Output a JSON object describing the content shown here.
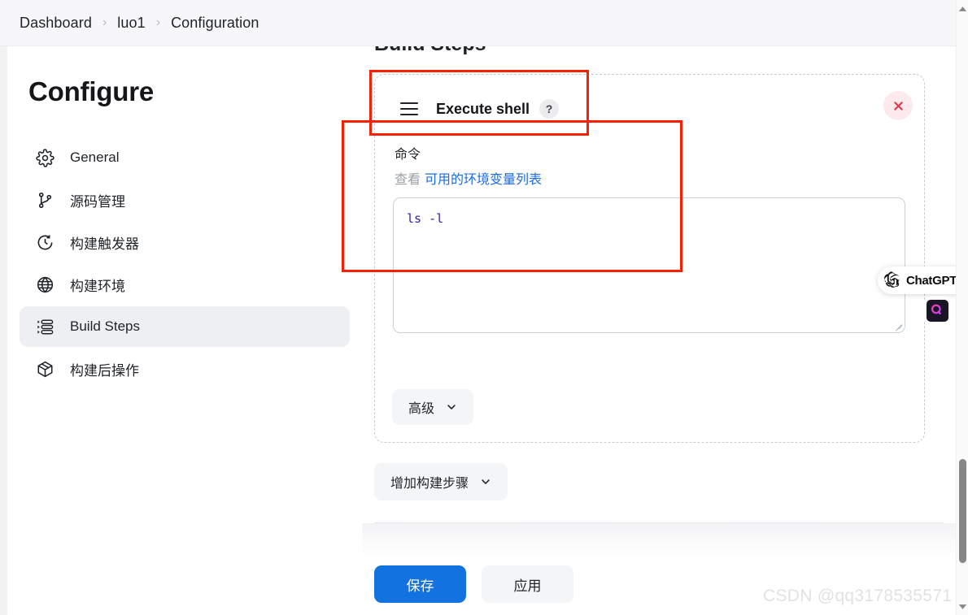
{
  "breadcrumb": {
    "items": [
      "Dashboard",
      "luo1",
      "Configuration"
    ],
    "separator": "›"
  },
  "sidebar": {
    "title": "Configure",
    "items": [
      {
        "label": "General",
        "icon": "gear-icon",
        "active": false
      },
      {
        "label": "源码管理",
        "icon": "source-branch-icon",
        "active": false
      },
      {
        "label": "构建触发器",
        "icon": "clock-icon",
        "active": false
      },
      {
        "label": "构建环境",
        "icon": "globe-icon",
        "active": false
      },
      {
        "label": "Build Steps",
        "icon": "list-icon",
        "active": true
      },
      {
        "label": "构建后操作",
        "icon": "package-icon",
        "active": false
      }
    ]
  },
  "main": {
    "section_heading": "Build Steps",
    "step": {
      "title": "Execute shell",
      "drag_handle_icon": "drag-handle-icon",
      "help_icon": "help-question-icon",
      "close_icon": "close-x-icon",
      "field_label": "命令",
      "hint_prefix": "查看",
      "hint_link": "可用的环境变量列表",
      "command_value": "ls -l",
      "command_placeholder": "",
      "advanced_label": "高级",
      "chevron_icon": "chevron-down-icon"
    },
    "add_step_label": "增加构建步骤",
    "save_label": "保存",
    "apply_label": "应用"
  },
  "overlays": {
    "chatgpt_label": "ChatGPT",
    "chatgpt_logo_icon": "chatgpt-knot-icon",
    "ai_chip_icon": "ai-assistant-icon",
    "watermark": "CSDN @qq3178535571"
  },
  "scrollbar": {
    "up_icon": "scroll-up-arrow-icon",
    "down_icon": "scroll-down-arrow-icon"
  },
  "colors": {
    "annotation": "#f81f03",
    "primary": "#1272e0",
    "link": "#1a6ce7",
    "code": "#2c1fb0"
  }
}
